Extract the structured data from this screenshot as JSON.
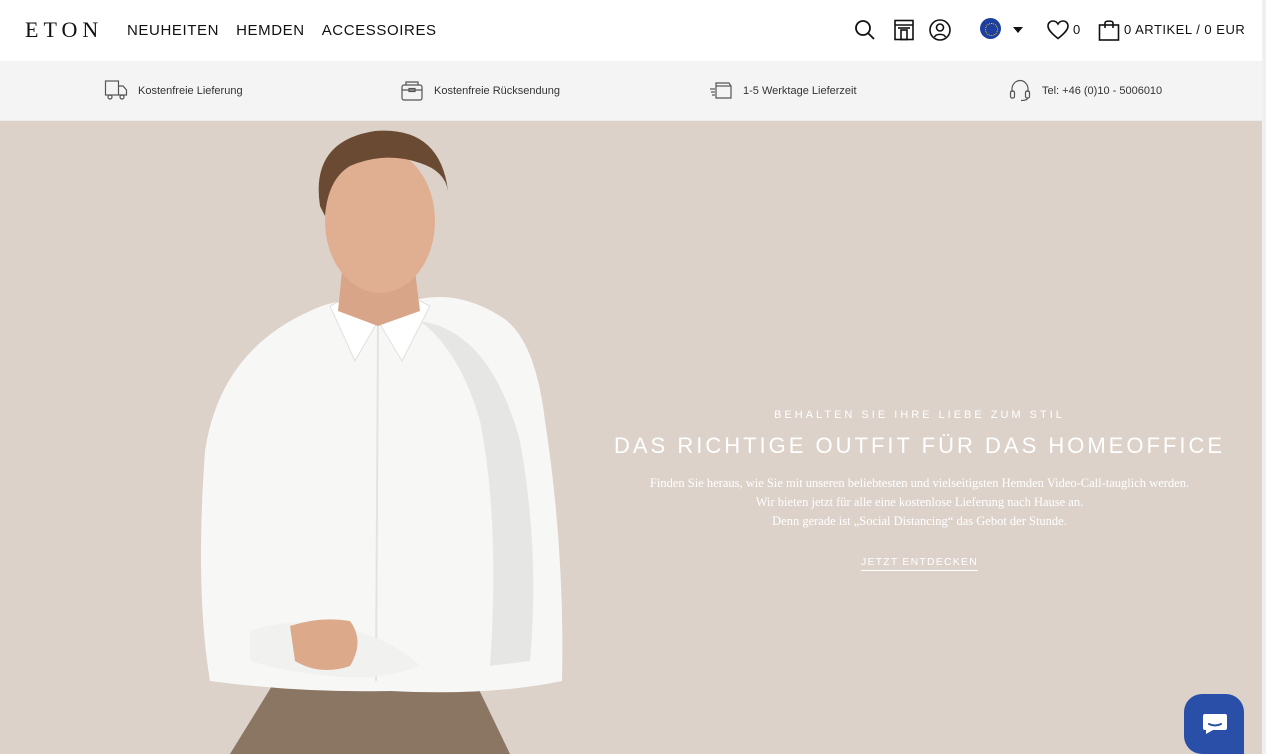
{
  "header": {
    "logo": "ETON",
    "nav": [
      "NEUHEITEN",
      "HEMDEN",
      "ACCESSOIRES"
    ],
    "icons": [
      "search-icon",
      "store-icon",
      "account-icon",
      "eu-flag-icon",
      "chevron-down-icon",
      "heart-icon",
      "shopping-bag-icon"
    ],
    "wishlist_count": "0",
    "cart_summary": "0 ARTIKEL / 0 EUR"
  },
  "usp": [
    {
      "icon": "truck-icon",
      "label": "Kostenfreie Lieferung"
    },
    {
      "icon": "return-box-icon",
      "label": "Kostenfreie Rücksendung"
    },
    {
      "icon": "fast-delivery-icon",
      "label": "1-5 Werktage Lieferzeit"
    },
    {
      "icon": "headset-icon",
      "label": "Tel: +46 (0)10 - 5006010"
    }
  ],
  "hero": {
    "kicker": "BEHALTEN SIE IHRE LIEBE ZUM STIL",
    "title": "DAS RICHTIGE OUTFIT FÜR DAS HOMEOFFICE",
    "body_lines": [
      "Finden Sie heraus, wie Sie mit unseren beliebtesten und vielseitigsten Hemden Video-Call-tauglich werden.",
      "Wir bieten jetzt für alle eine kostenlose Lieferung nach Hause an.",
      "Denn gerade ist „Social Distancing“ das Gebot der Stunde."
    ],
    "cta": "JETZT ENTDECKEN",
    "background_color": "#dcd2ca"
  },
  "chat": {
    "icon": "chat-bubble-icon",
    "color": "#2a4fa8"
  }
}
